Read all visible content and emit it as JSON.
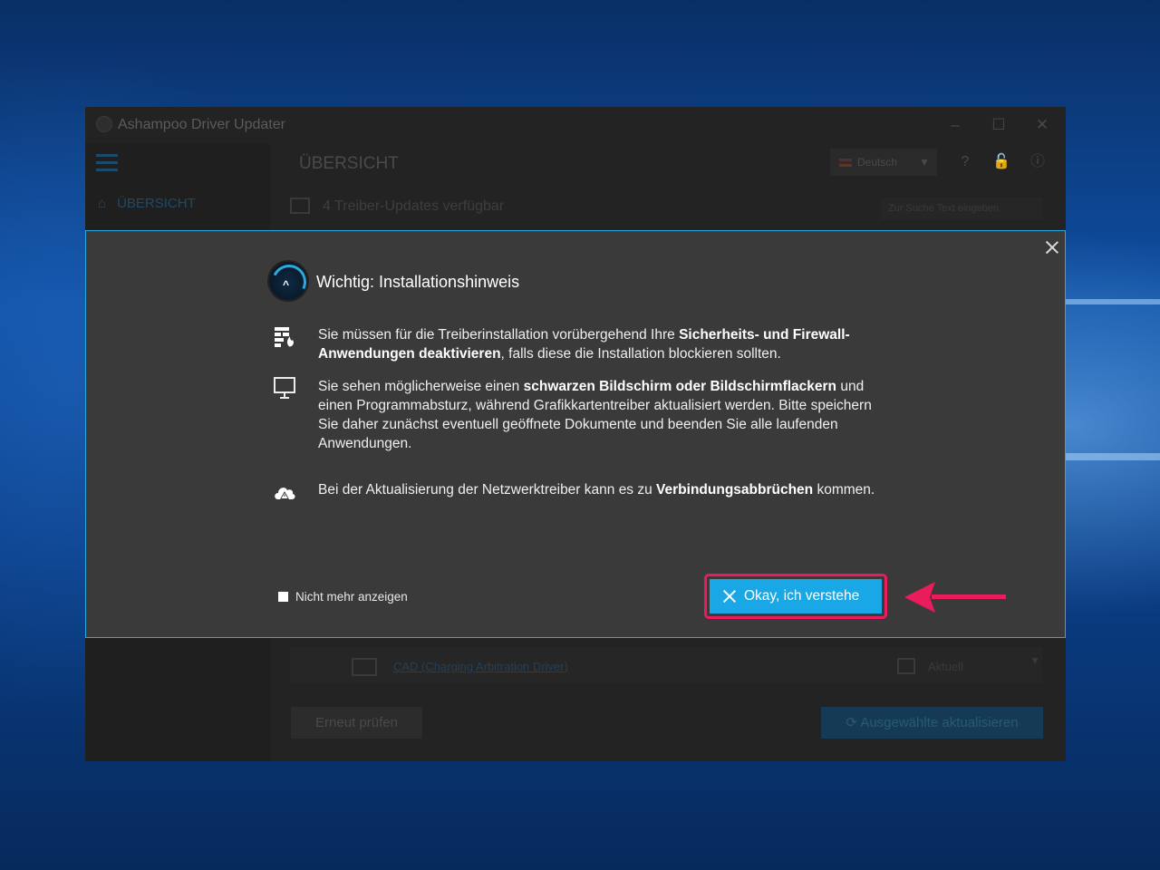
{
  "window": {
    "title": "Ashampoo Driver Updater",
    "controls": [
      "minimize",
      "maximize",
      "close"
    ]
  },
  "background_app": {
    "header_title": "ÜBERSICHT",
    "sidebar": {
      "items": [
        {
          "label": "ÜBERSICHT",
          "icon": "home-icon"
        }
      ]
    },
    "language": {
      "value": "Deutsch"
    },
    "header_icons": [
      "help-icon",
      "lock-icon",
      "info-icon"
    ],
    "updates_text": "4 Treiber-Updates verfügbar",
    "search": {
      "placeholder": "Zur Suche Text eingeben"
    },
    "driver_row": {
      "name": "CAD (Charging Arbitration Driver)",
      "status": "Aktuell"
    },
    "buttons": {
      "recheck": "Erneut prüfen",
      "update_selected": "Ausgewählte aktualisieren"
    }
  },
  "dialog": {
    "title": "Wichtig:  Installationshinweis",
    "paragraphs": [
      {
        "icon": "firewall-icon",
        "t1": "Sie müssen für die Treiberinstallation vorübergehend Ihre ",
        "b1": "Sicherheits- und Firewall-Anwendungen deaktivieren",
        "t2": ", falls diese die Installation blockieren sollten."
      },
      {
        "icon": "monitor-icon",
        "t1": "Sie sehen möglicherweise einen ",
        "b1": "schwarzen Bildschirm oder Bildschirmflackern",
        "t2": " und einen Programmabsturz, während Grafikkartentreiber aktualisiert werden. Bitte speichern Sie daher zunächst eventuell geöffnete Dokumente und beenden Sie alle laufenden Anwendungen."
      },
      {
        "icon": "cloud-warning-icon",
        "t1": "Bei der Aktualisierung der Netzwerktreiber kann es zu ",
        "b1": "Verbindungsabbrüchen",
        "t2": " kommen."
      }
    ],
    "checkbox_label": "Nicht mehr anzeigen",
    "ok_button": "Okay, ich verstehe"
  },
  "colors": {
    "accent": "#1aa7e6",
    "highlight": "#ea1c5c",
    "dialog_bg": "#3a3a3a",
    "dialog_border": "#2aa8e0"
  }
}
